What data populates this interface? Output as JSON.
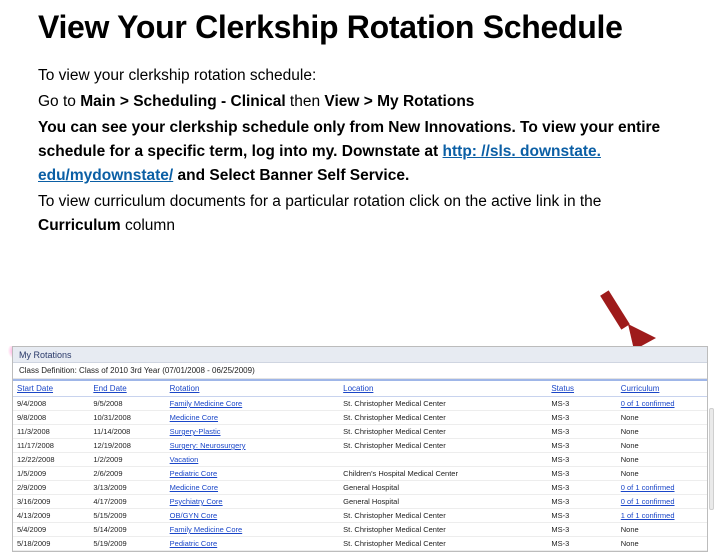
{
  "title": "View Your Clerkship Rotation Schedule",
  "intro_line": "To view your clerkship rotation schedule:",
  "nav_prefix": "Go to ",
  "nav_main": "Main > Scheduling - Clinical",
  "nav_then": " then ",
  "nav_view": "View > My Rotations",
  "note1a": "You can see your clerkship schedule only from New Innovations.  To view your entire schedule for a specific term, log into my. Downstate at ",
  "note1_link_text": "http: //sls. downstate. edu/mydownstate/",
  "note1_link_href": "http://sls.downstate.edu/mydownstate/",
  "note1b": " and Select Banner Self Service.",
  "note2a": "To view curriculum documents for a particular rotation click on the active link in the ",
  "note2_col": "Curriculum",
  "note2b": " column",
  "grid": {
    "tab_label": "My Rotations",
    "classdef_label": "Class Definition:",
    "classdef_value": "Class of 2010 3rd Year (07/01/2008 - 06/25/2009) ",
    "headers": {
      "start": "Start Date",
      "end": "End Date",
      "rotation": "Rotation",
      "location": "Location",
      "status": "Status",
      "curriculum": "Curriculum"
    },
    "rows": [
      {
        "start": "9/4/2008",
        "end": "9/5/2008",
        "rotation": "Family Medicine Core",
        "location": "St. Christopher Medical Center",
        "status": "MS-3",
        "curric": "0 of 1 confirmed",
        "curric_link": true
      },
      {
        "start": "9/8/2008",
        "end": "10/31/2008",
        "rotation": "Medicine Core",
        "location": "St. Christopher Medical Center",
        "status": "MS-3",
        "curric": "None",
        "curric_link": false
      },
      {
        "start": "11/3/2008",
        "end": "11/14/2008",
        "rotation": "Surgery-Plastic",
        "location": "St. Christopher Medical Center",
        "status": "MS-3",
        "curric": "None",
        "curric_link": false
      },
      {
        "start": "11/17/2008",
        "end": "12/19/2008",
        "rotation": "Surgery: Neurosurgery",
        "location": "St. Christopher Medical Center",
        "status": "MS-3",
        "curric": "None",
        "curric_link": false
      },
      {
        "start": "12/22/2008",
        "end": "1/2/2009",
        "rotation": "Vacation",
        "location": "",
        "status": "MS-3",
        "curric": "None",
        "curric_link": false
      },
      {
        "start": "1/5/2009",
        "end": "2/6/2009",
        "rotation": "Pediatric Core",
        "location": "Children's Hospital Medical Center",
        "status": "MS-3",
        "curric": "None",
        "curric_link": false
      },
      {
        "start": "2/9/2009",
        "end": "3/13/2009",
        "rotation": "Medicine Core",
        "location": "General Hospital",
        "status": "MS-3",
        "curric": "0 of 1 confirmed",
        "curric_link": true
      },
      {
        "start": "3/16/2009",
        "end": "4/17/2009",
        "rotation": "Psychiatry Core",
        "location": "General Hospital",
        "status": "MS-3",
        "curric": "0 of 1 confirmed",
        "curric_link": true
      },
      {
        "start": "4/13/2009",
        "end": "5/15/2009",
        "rotation": "OB/GYN Core",
        "location": "St. Christopher Medical Center",
        "status": "MS-3",
        "curric": "1 of 1 confirmed",
        "curric_link": true
      },
      {
        "start": "5/4/2009",
        "end": "5/14/2009",
        "rotation": "Family Medicine Core",
        "location": "St. Christopher Medical Center",
        "status": "MS-3",
        "curric": "None",
        "curric_link": false
      },
      {
        "start": "5/18/2009",
        "end": "5/19/2009",
        "rotation": "Pediatric Core",
        "location": "St. Christopher Medical Center",
        "status": "MS-3",
        "curric": "None",
        "curric_link": false
      }
    ]
  }
}
